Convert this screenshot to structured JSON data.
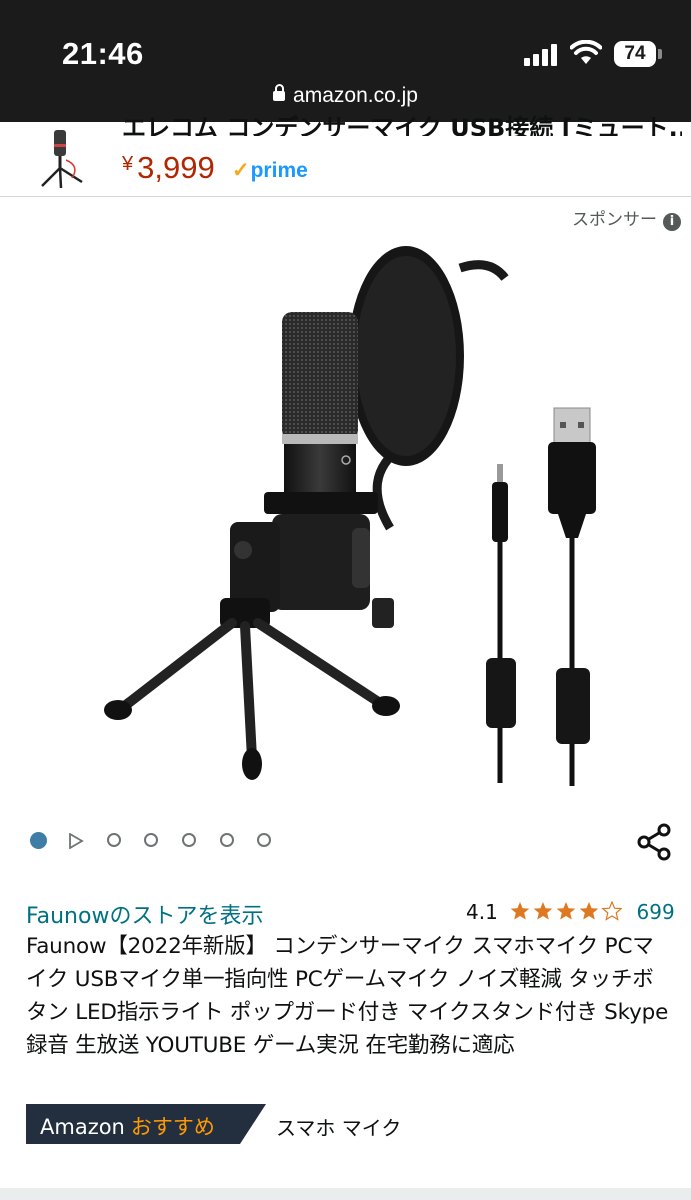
{
  "status_bar": {
    "time": "21:46",
    "battery": "74"
  },
  "browser": {
    "url": "amazon.co.jp"
  },
  "sticky_header": {
    "title": "エレコム コンデンサーマイク USB接続 [ミュート...",
    "currency": "¥",
    "price": "3,999",
    "prime_label": "prime"
  },
  "sponsor": {
    "label": "スポンサー"
  },
  "gallery": {
    "image_count": 7,
    "active_index": 0
  },
  "product": {
    "store_link": "Faunowのストアを表示",
    "rating": "4.1",
    "stars": 4.1,
    "review_count": "699",
    "title": "Faunow【2022年新版】 コンデンサーマイク スマホマイク PCマイク USBマイク単一指向性 PCゲームマイク ノイズ軽減 タッチボタン LED指示ライト ポップガード付き マイクスタンド付き Skype 録音 生放送 YOUTUBE ゲーム実況 在宅勤務に適応"
  },
  "badge": {
    "brand": "Amazon",
    "label": "おすすめ",
    "keyword": "スマホ マイク"
  },
  "colors": {
    "link": "#007185",
    "price": "#b12704",
    "star": "#de7921",
    "badge_bg": "#232f3e",
    "badge_accent": "#ff9900",
    "dot_active": "#3e7ea6"
  }
}
